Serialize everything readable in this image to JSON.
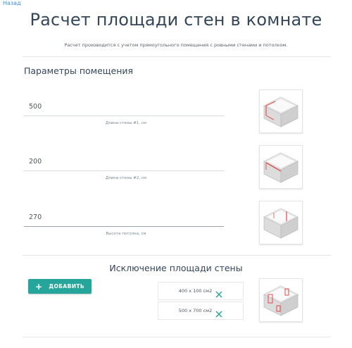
{
  "nav": {
    "back_label": "Назад"
  },
  "header": {
    "title": "Расчет площади стен в комнате",
    "subtitle": "Расчет производится с учетом прямоугольного помещения с ровными стенами и потолком."
  },
  "room_params": {
    "title": "Параметры помещения",
    "fields": [
      {
        "value": "500",
        "caption": "Длина стены #1, см"
      },
      {
        "value": "200",
        "caption": "Длина стены #2, см"
      },
      {
        "value": "270",
        "caption": "Высота потолка, см"
      }
    ]
  },
  "exclusions": {
    "title": "Исключение площади стены",
    "add_label": "ДОБАВИТЬ",
    "items": [
      {
        "label": "400 x 100 см2"
      },
      {
        "label": "500 x 700 см2"
      }
    ]
  },
  "colors": {
    "accent": "#26a69a",
    "link": "#3b8fd6",
    "highlight": "#e53935",
    "text": "#34475a"
  },
  "icons": [
    "room-wall-1-icon",
    "room-wall-2-icon",
    "room-height-icon",
    "room-openings-icon",
    "plus-icon",
    "close-icon"
  ]
}
